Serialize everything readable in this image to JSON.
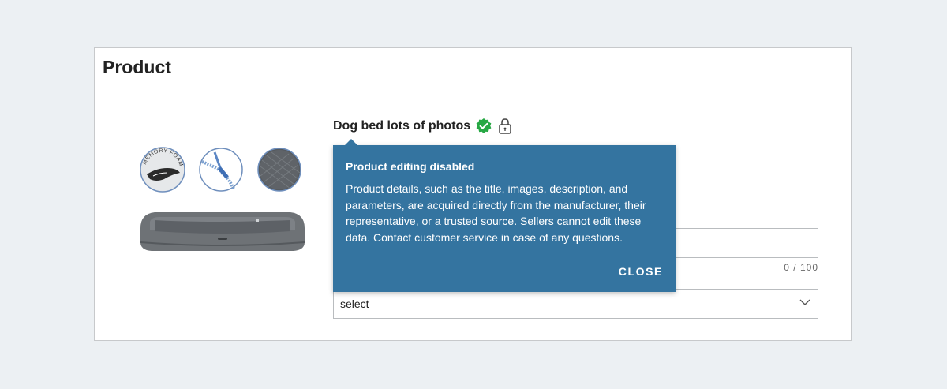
{
  "page": {
    "title": "Product"
  },
  "product": {
    "name": "Dog bed lots of photos",
    "image_feature_text": "MEMORY FOAM",
    "verified_icon": "verified-check-icon",
    "lock_icon": "lock-icon"
  },
  "form": {
    "text_value": "",
    "counter": {
      "current": "0",
      "separator": "/",
      "max": "100",
      "display": "0 / 100"
    },
    "select": {
      "value": "select",
      "icon": "chevron-down-icon"
    }
  },
  "tooltip": {
    "title": "Product editing disabled",
    "body": "Product details, such as the title, images, description, and parameters, are acquired directly from the manufacturer, their representative, or a trusted source. Sellers cannot edit these data. Contact customer service in case of any questions.",
    "close_label": "CLOSE"
  },
  "colors": {
    "background": "#ecf0f3",
    "tooltip": "#3474a0",
    "verified": "#27a844",
    "accent": "#4aa38f"
  }
}
